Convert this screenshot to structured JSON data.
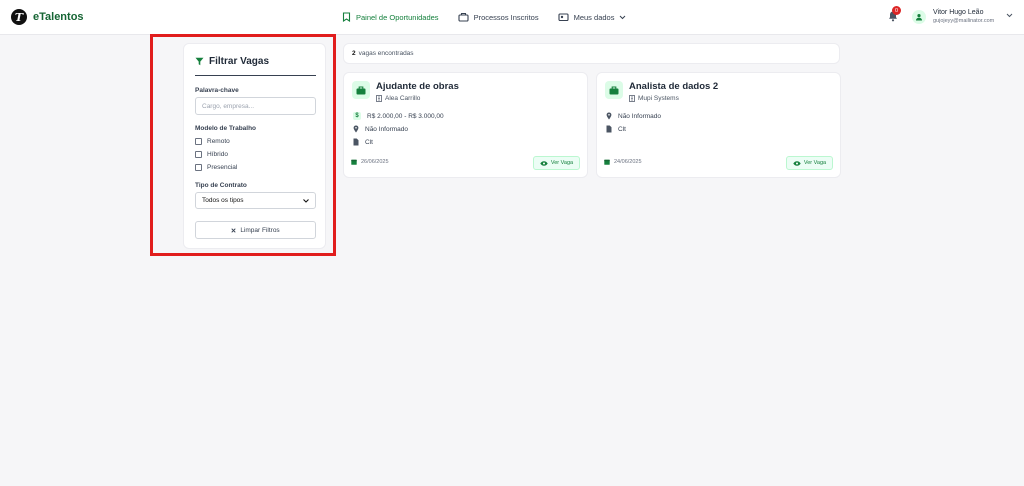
{
  "header": {
    "brand_name": "eTalentos",
    "brand_logo_letter": "T",
    "nav": [
      {
        "label": "Painel de Oportunidades",
        "icon": "bookmark-icon",
        "active": true
      },
      {
        "label": "Processos Inscritos",
        "icon": "briefcase-icon",
        "active": false
      },
      {
        "label": "Meus dados",
        "icon": "id-card-icon",
        "active": false
      }
    ],
    "notifications_count": "0",
    "user_name": "Vitor Hugo Leão",
    "user_email": "gujojeyy@mailinator.com"
  },
  "filters": {
    "title": "Filtrar Vagas",
    "keyword_label": "Palavra-chave",
    "keyword_placeholder": "Cargo, empresa...",
    "keyword_value": "",
    "work_model_label": "Modelo de Trabalho",
    "work_models": [
      {
        "label": "Remoto",
        "checked": false
      },
      {
        "label": "Híbrido",
        "checked": false
      },
      {
        "label": "Presencial",
        "checked": false
      }
    ],
    "contract_label": "Tipo de Contrato",
    "contract_selected": "Todos os tipos",
    "clear_label": "Limpar Filtros"
  },
  "results": {
    "count": "2",
    "label": "vagas encontradas"
  },
  "jobs": [
    {
      "title": "Ajudante de obras",
      "company": "Alea Carrillo",
      "salary": "R$ 2.000,00 - R$ 3.000,00",
      "location": "Não Informado",
      "contract": "Clt",
      "date": "26/06/2025",
      "button": "Ver Vaga"
    },
    {
      "title": "Analista de dados 2",
      "company": "Mupi Systems",
      "location": "Não Informado",
      "contract": "Clt",
      "date": "24/06/2025",
      "button": "Ver Vaga"
    }
  ],
  "colors": {
    "brand_green": "#15803d",
    "highlight_red": "#e11d1d",
    "badge_red": "#dc2626"
  }
}
